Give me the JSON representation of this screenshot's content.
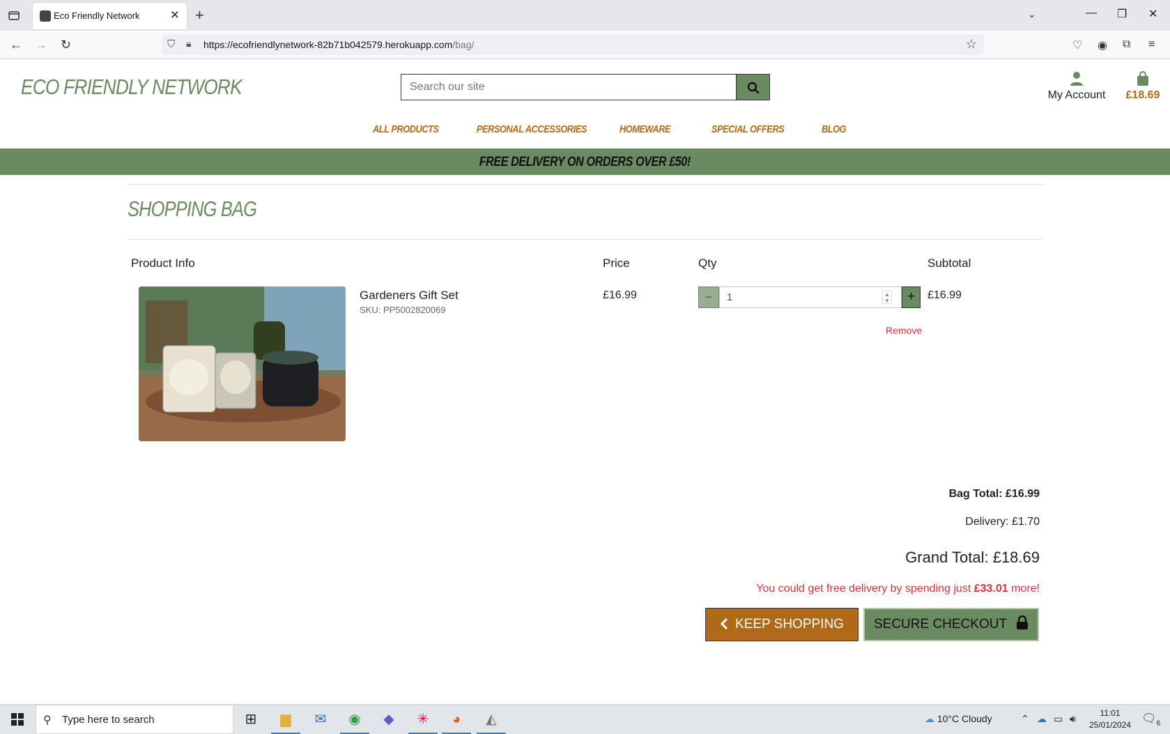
{
  "browser": {
    "tab_title": "Eco Friendly Network",
    "url_host": "https://ecofriendlynetwork-82b71b042579.herokuapp.com",
    "url_path": "/bag/"
  },
  "site": {
    "logo": "ECO FRIENDLY NETWORK",
    "search_placeholder": "Search our site",
    "account_label": "My Account",
    "bag_total": "£18.69",
    "nav": [
      "ALL PRODUCTS",
      "PERSONAL ACCESSORIES",
      "HOMEWARE",
      "SPECIAL OFFERS",
      "BLOG"
    ],
    "banner": "FREE DELIVERY ON ORDERS OVER £50!",
    "brand_color": "#6a8a62",
    "accent_color": "#b06a17"
  },
  "bag": {
    "title": "SHOPPING BAG",
    "columns": {
      "product": "Product Info",
      "price": "Price",
      "qty": "Qty",
      "subtotal": "Subtotal"
    },
    "items": [
      {
        "name": "Gardeners Gift Set",
        "sku": "SKU: PP5002820069",
        "price": "£16.99",
        "qty": "1",
        "subtotal": "£16.99",
        "remove": "Remove",
        "image_alt": "Candles and jars on a table"
      }
    ],
    "bag_total": "Bag Total: £16.99",
    "delivery": "Delivery: £1.70",
    "grand_total": "Grand Total: £18.69",
    "free_delivery_prefix": "You could get free delivery by spending just ",
    "free_delivery_amount": "£33.01",
    "free_delivery_suffix": " more!",
    "keep_shopping": "KEEP SHOPPING",
    "secure_checkout": "SECURE CHECKOUT"
  },
  "taskbar": {
    "search_text": "Type here to search",
    "weather": "10°C  Cloudy",
    "time": "11:01",
    "date": "25/01/2024",
    "notifications": "6"
  }
}
